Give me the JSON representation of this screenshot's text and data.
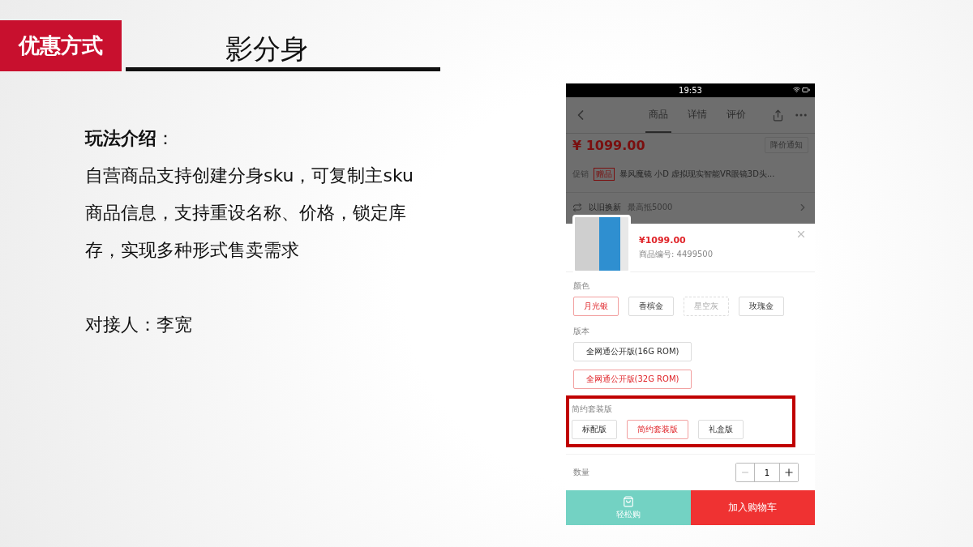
{
  "header": {
    "badge": "优惠方式",
    "title": "影分身"
  },
  "intro": {
    "heading": "**玩法介绍**：",
    "body": "自营商品支持创建分身sku，可复制主sku商品信息，支持重设名称、价格，锁定库存，实现多种形式售卖需求",
    "contact": "对接人：李宽"
  },
  "phone": {
    "status_time": "19:53",
    "tabs": [
      {
        "label": "商品",
        "selected": true
      },
      {
        "label": "详情",
        "selected": false
      },
      {
        "label": "评价",
        "selected": false
      }
    ],
    "price": "¥ 1099.00",
    "notify_button": "降价通知",
    "promo": {
      "label": "促销",
      "tag": "赠品",
      "text": "暴风魔镜 小D 虚拟现实智能VR眼镜3D头..."
    },
    "trade_in": {
      "label": "以旧换新",
      "note": "最高抵5000"
    },
    "sheet": {
      "price": "¥1099.00",
      "code": "商品编号: 4499500",
      "groups": [
        {
          "title": "颜色",
          "highlighted": false,
          "options": [
            {
              "label": "月光银",
              "selected": true,
              "disabled": false
            },
            {
              "label": "香槟金",
              "selected": false,
              "disabled": false
            },
            {
              "label": "星空灰",
              "selected": false,
              "disabled": true
            },
            {
              "label": "玫瑰金",
              "selected": false,
              "disabled": false
            }
          ]
        },
        {
          "title": "版本",
          "highlighted": false,
          "options": [
            {
              "label": "全网通公开版(16G ROM)",
              "selected": false,
              "disabled": false
            },
            {
              "label": "全网通公开版(32G ROM)",
              "selected": true,
              "disabled": false
            }
          ]
        },
        {
          "title": "简约套装版",
          "highlighted": true,
          "options": [
            {
              "label": "标配版",
              "selected": false,
              "disabled": false
            },
            {
              "label": "简约套装版",
              "selected": true,
              "disabled": false
            },
            {
              "label": "礼盒版",
              "selected": false,
              "disabled": false
            }
          ]
        }
      ],
      "quantity_label": "数量",
      "quantity": "1",
      "quick_buy": "轻松购",
      "add_to_cart": "加入购物车"
    }
  }
}
